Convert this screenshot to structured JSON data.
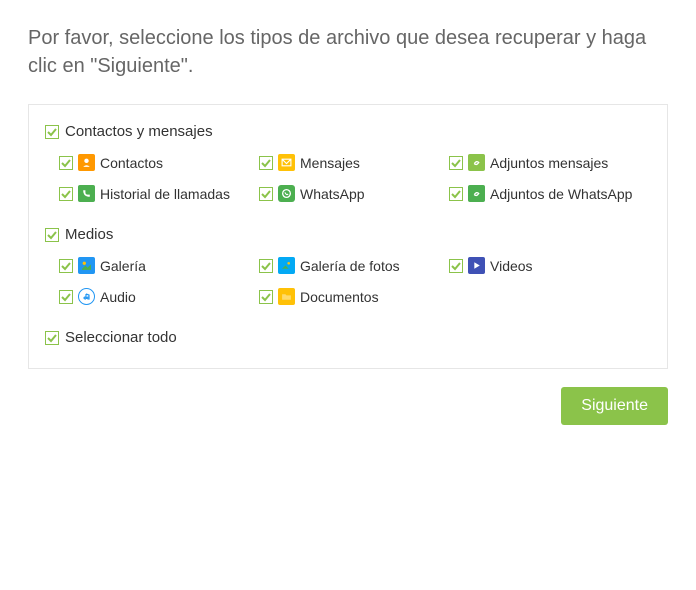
{
  "instruction": "Por favor, seleccione los tipos de archivo que desea recuperar y haga clic en \"Siguiente\".",
  "sections": {
    "contacts": {
      "title": "Contactos y mensajes",
      "items": {
        "contacts": "Contactos",
        "messages": "Mensajes",
        "msg_attachments": "Adjuntos mensajes",
        "call_history": "Historial de llamadas",
        "whatsapp": "WhatsApp",
        "wa_attachments": "Adjuntos de WhatsApp"
      }
    },
    "media": {
      "title": "Medios",
      "items": {
        "gallery": "Galería",
        "photo_gallery": "Galería de fotos",
        "videos": "Videos",
        "audio": "Audio",
        "documents": "Documentos"
      }
    }
  },
  "select_all": "Seleccionar todo",
  "next_button": "Siguiente",
  "colors": {
    "accent": "#8bc34a",
    "contacts": "#ff9800",
    "messages": "#ffc107",
    "attachments": "#8bc34a",
    "call": "#4caf50",
    "whatsapp": "#4caf50",
    "wa_attach": "#4caf50",
    "gallery": "#2196f3",
    "photo": "#03a9f4",
    "video": "#3f51b5",
    "audio": "#2196f3",
    "docs": "#ffc107"
  }
}
